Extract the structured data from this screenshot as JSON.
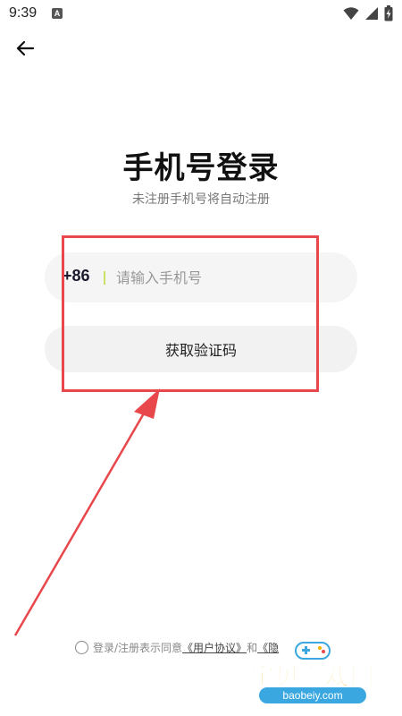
{
  "status_bar": {
    "time": "9:39",
    "app_icon_letter": "A",
    "icons": [
      "wifi-icon",
      "signal-icon",
      "battery-icon"
    ]
  },
  "header": {
    "back_icon": "arrow-left-icon"
  },
  "login": {
    "title": "手机号登录",
    "subtitle": "未注册手机号将自动注册",
    "country_code": "+86",
    "phone_placeholder": "请输入手机号",
    "phone_value": "",
    "get_code_label": "获取验证码"
  },
  "agreement": {
    "prefix": "登录/注册表示同意",
    "user_agreement": "《用户协议》",
    "and": "和",
    "privacy_partial": "《隐"
  },
  "watermark": {
    "title": "宝贝游戏网",
    "url": "baobeiy.com"
  },
  "colors": {
    "annotation_red": "#e8474c",
    "divider_green": "#c9e265",
    "field_bg": "#f5f5f5",
    "watermark_yellow": "#f5b400",
    "watermark_blue": "#3aa7e0"
  }
}
